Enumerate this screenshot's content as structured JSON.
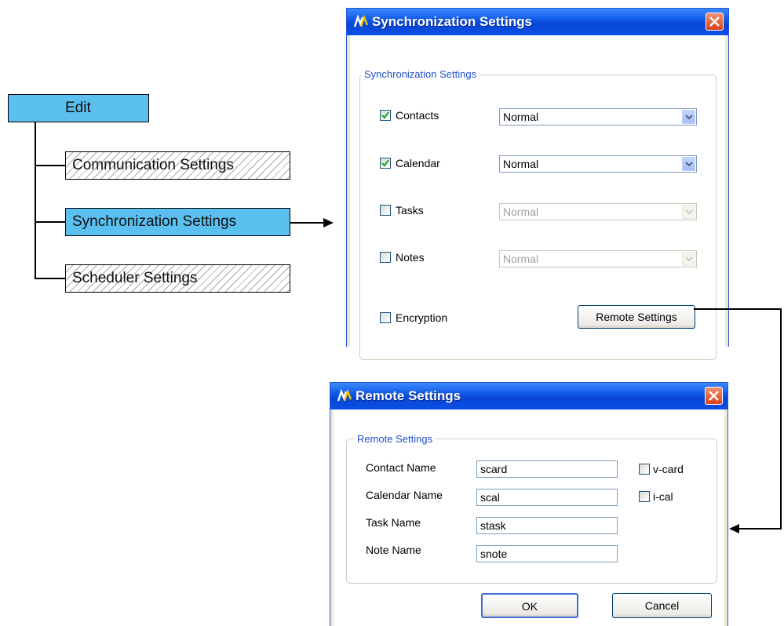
{
  "tree": {
    "root": "Edit",
    "items": [
      "Communication Settings",
      "Synchronization Settings",
      "Scheduler Settings"
    ]
  },
  "sync_dialog": {
    "title": "Synchronization Settings",
    "group_title": "Synchronization Settings",
    "rows": [
      {
        "label": "Contacts",
        "checked": true,
        "mode": "Normal",
        "enabled": true
      },
      {
        "label": "Calendar",
        "checked": true,
        "mode": "Normal",
        "enabled": true
      },
      {
        "label": "Tasks",
        "checked": false,
        "mode": "Normal",
        "enabled": false
      },
      {
        "label": "Notes",
        "checked": false,
        "mode": "Normal",
        "enabled": false
      }
    ],
    "encryption_label": "Encryption",
    "encryption_checked": false,
    "remote_button": "Remote Settings"
  },
  "remote_dialog": {
    "title": "Remote Settings",
    "group_title": "Remote Settings",
    "fields": [
      {
        "label": "Contact Name",
        "value": "scard"
      },
      {
        "label": "Calendar Name",
        "value": "scal"
      },
      {
        "label": "Task Name",
        "value": "stask"
      },
      {
        "label": "Note Name",
        "value": "snote"
      }
    ],
    "vcard_label": "v-card",
    "ical_label": "i-cal",
    "ok_label": "OK",
    "cancel_label": "Cancel"
  },
  "colors": {
    "highlight": "#5bbfef",
    "title_bar": "#0a4fe6",
    "group_title": "#1f4fd0",
    "close_button": "#d9411b"
  },
  "icons": [
    "app-logo-icon",
    "close-icon",
    "checkmark-icon",
    "dropdown-arrow-icon",
    "arrow-right-icon",
    "arrow-left-icon"
  ]
}
